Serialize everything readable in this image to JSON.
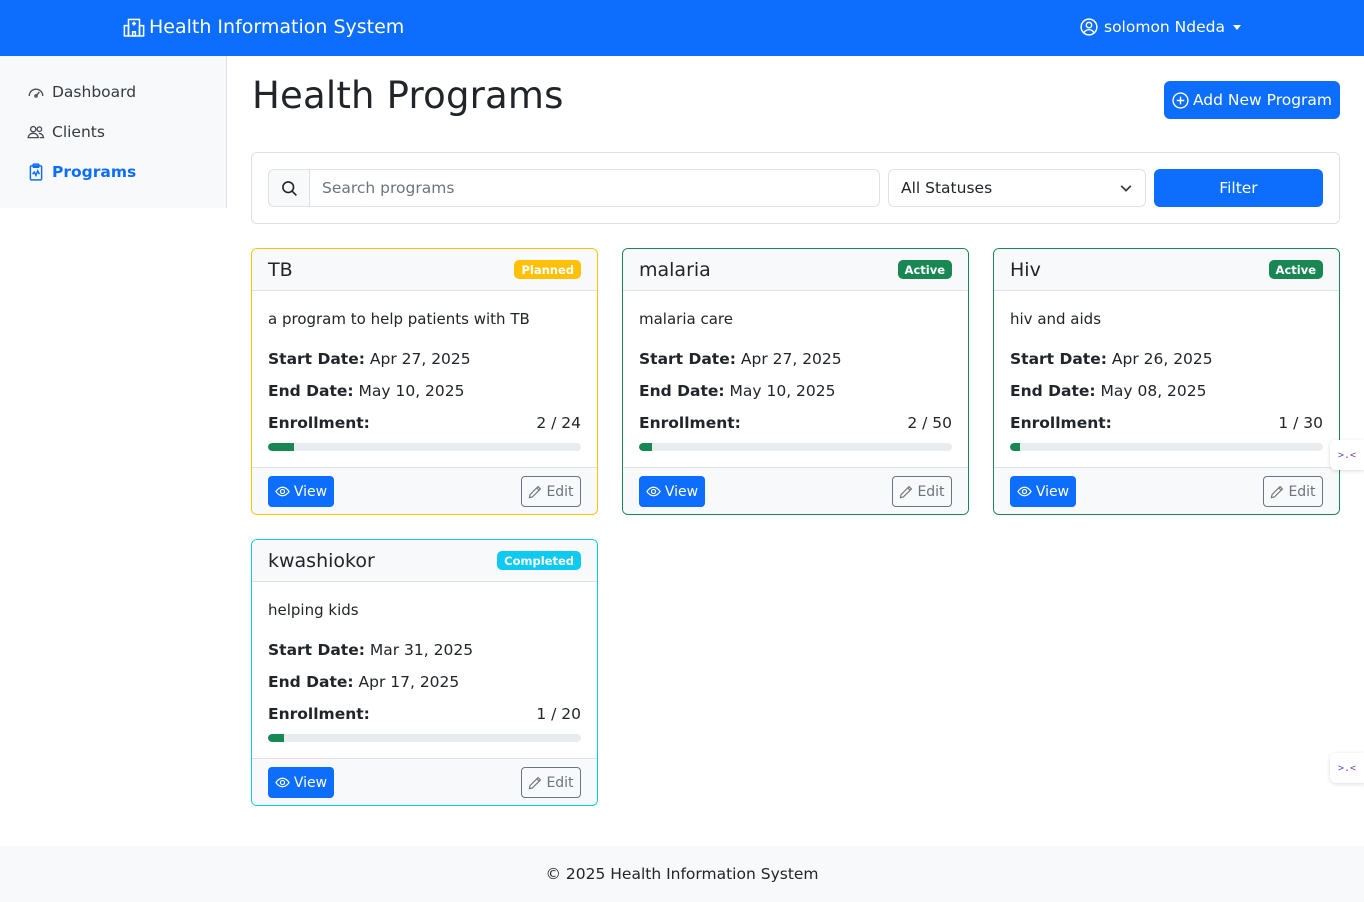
{
  "navbar": {
    "brand": "Health Information System",
    "user": "solomon Ndeda"
  },
  "sidebar": {
    "items": [
      {
        "label": "Dashboard",
        "icon": "speedometer-icon"
      },
      {
        "label": "Clients",
        "icon": "people-icon"
      },
      {
        "label": "Programs",
        "icon": "clipboard-icon"
      }
    ]
  },
  "main": {
    "title": "Health Programs",
    "add_button": "Add New Program"
  },
  "filters": {
    "search_placeholder": "Search programs",
    "status_selected": "All Statuses",
    "filter_button": "Filter"
  },
  "programs": [
    {
      "name": "TB",
      "status": "Planned",
      "description": "a program to help patients with TB",
      "start_label": "Start Date:",
      "start_date": "Apr 27, 2025",
      "end_label": "End Date:",
      "end_date": "May 10, 2025",
      "enrollment_label": "Enrollment:",
      "enrollment": "2 / 24",
      "enrollment_fraction": 0.083,
      "view": "View",
      "edit": "Edit"
    },
    {
      "name": "malaria",
      "status": "Active",
      "description": "malaria care",
      "start_label": "Start Date:",
      "start_date": "Apr 27, 2025",
      "end_label": "End Date:",
      "end_date": "May 10, 2025",
      "enrollment_label": "Enrollment:",
      "enrollment": "2 / 50",
      "enrollment_fraction": 0.04,
      "view": "View",
      "edit": "Edit"
    },
    {
      "name": "Hiv",
      "status": "Active",
      "description": "hiv and aids",
      "start_label": "Start Date:",
      "start_date": "Apr 26, 2025",
      "end_label": "End Date:",
      "end_date": "May 08, 2025",
      "enrollment_label": "Enrollment:",
      "enrollment": "1 / 30",
      "enrollment_fraction": 0.033,
      "view": "View",
      "edit": "Edit"
    },
    {
      "name": "kwashiokor",
      "status": "Completed",
      "description": "helping kids",
      "start_label": "Start Date:",
      "start_date": "Mar 31, 2025",
      "end_label": "End Date:",
      "end_date": "Apr 17, 2025",
      "enrollment_label": "Enrollment:",
      "enrollment": "1 / 20",
      "enrollment_fraction": 0.05,
      "view": "View",
      "edit": "Edit"
    }
  ],
  "footer": {
    "text": "© 2025 Health Information System"
  },
  "colors": {
    "primary": "#0d6efd",
    "success": "#198754",
    "warning": "#ffc107",
    "info": "#0dcaf0"
  }
}
